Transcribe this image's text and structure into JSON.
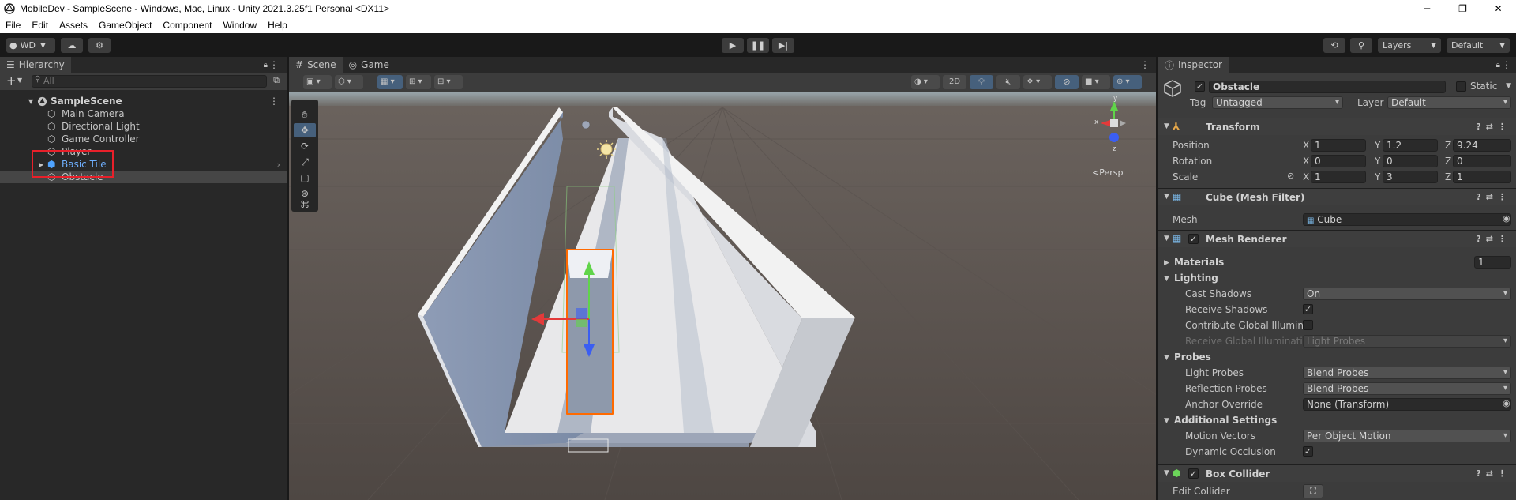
{
  "window": {
    "title": "MobileDev - SampleScene - Windows, Mac, Linux - Unity 2021.3.25f1 Personal <DX11>"
  },
  "menu": [
    "File",
    "Edit",
    "Assets",
    "GameObject",
    "Component",
    "Window",
    "Help"
  ],
  "toolbar": {
    "account": "WD",
    "layers": "Layers",
    "layout": "Default"
  },
  "hierarchy": {
    "tab": "Hierarchy",
    "search_placeholder": "All",
    "scene": "SampleScene",
    "items": [
      {
        "label": "Main Camera"
      },
      {
        "label": "Directional Light"
      },
      {
        "label": "Game Controller"
      },
      {
        "label": "Player"
      },
      {
        "label": "Basic Tile"
      },
      {
        "label": "Obstacle"
      }
    ]
  },
  "scene_view": {
    "tabs": [
      "Scene",
      "Game"
    ],
    "mode_2d": "2D",
    "persp": "<Persp",
    "gizmo_labels": {
      "y": "y",
      "x": "x",
      "z": "z"
    }
  },
  "inspector": {
    "tab": "Inspector",
    "object_name": "Obstacle",
    "static_label": "Static",
    "tag_label": "Tag",
    "tag_value": "Untagged",
    "layer_label": "Layer",
    "layer_value": "Default",
    "transform": {
      "title": "Transform",
      "position": {
        "label": "Position",
        "x": "1",
        "y": "1.2",
        "z": "9.24"
      },
      "rotation": {
        "label": "Rotation",
        "x": "0",
        "y": "0",
        "z": "0"
      },
      "scale": {
        "label": "Scale",
        "x": "1",
        "y": "3",
        "z": "1"
      }
    },
    "mesh_filter": {
      "title": "Cube (Mesh Filter)",
      "mesh_label": "Mesh",
      "mesh_value": "Cube"
    },
    "mesh_renderer": {
      "title": "Mesh Renderer",
      "materials_label": "Materials",
      "materials_count": "1",
      "lighting": "Lighting",
      "cast_shadows_label": "Cast Shadows",
      "cast_shadows_value": "On",
      "receive_shadows_label": "Receive Shadows",
      "contribute_gi_label": "Contribute Global Illuminat",
      "receive_gi_label": "Receive Global Illuminatior",
      "receive_gi_value": "Light Probes",
      "probes": "Probes",
      "light_probes_label": "Light Probes",
      "light_probes_value": "Blend Probes",
      "reflection_probes_label": "Reflection Probes",
      "reflection_probes_value": "Blend Probes",
      "anchor_override_label": "Anchor Override",
      "anchor_override_value": "None (Transform)",
      "additional_settings": "Additional Settings",
      "motion_vectors_label": "Motion Vectors",
      "motion_vectors_value": "Per Object Motion",
      "dynamic_occlusion_label": "Dynamic Occlusion"
    },
    "box_collider": {
      "title": "Box Collider",
      "edit_collider_label": "Edit Collider"
    }
  },
  "colors": {
    "selection_outline": "#ff6a00",
    "highlight_box": "#e8202a",
    "prefab_blue": "#4fa3ff"
  }
}
